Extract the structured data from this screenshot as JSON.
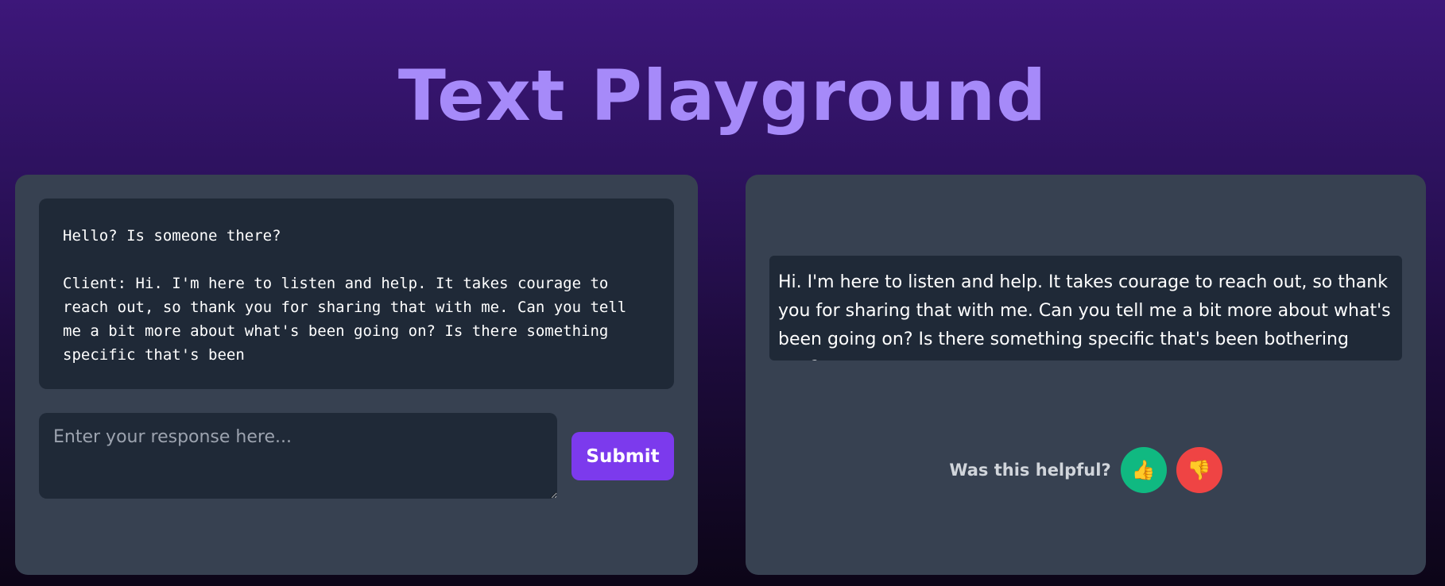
{
  "header": {
    "title": "Text Playground"
  },
  "left_panel": {
    "conversation_text": "Hello? Is someone there?\n\nClient: Hi. I'm here to listen and help. It takes courage to\nreach out, so thank you for sharing that with me. Can you tell\nme a bit more about what's been going on? Is there something\nspecific that's been",
    "response_input": {
      "value": "",
      "placeholder": "Enter your response here..."
    },
    "submit_label": "Submit"
  },
  "right_panel": {
    "reply_text": "Hi. I'm here to listen and help. It takes courage to reach out, so thank you for sharing that with me. Can you tell me a bit more about what's been going on? Is there something specific that's been bothering you?",
    "feedback": {
      "label": "Was this helpful?",
      "thumbs_up_icon": "👍",
      "thumbs_down_icon": "👎"
    }
  },
  "colors": {
    "accent": "#7c3aed",
    "title": "#a68af9",
    "panel": "#374151",
    "box": "#1f2937",
    "positive": "#10b981",
    "negative": "#ef4444"
  }
}
